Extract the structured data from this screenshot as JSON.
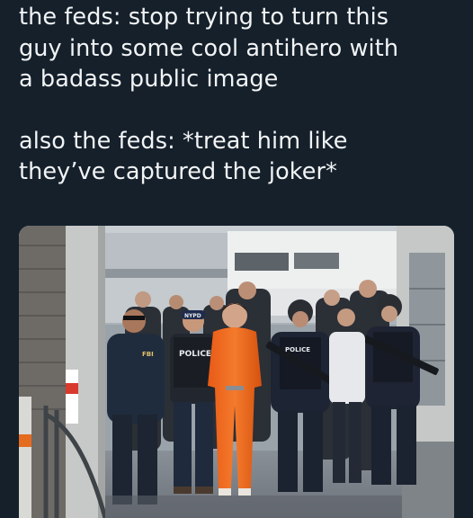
{
  "caption": {
    "line1": "the feds: stop trying to turn this",
    "line2": "guy into some cool antihero with",
    "line3": "a badass public image",
    "line4": "also the feds: *treat him like",
    "line5": "they’ve captured the joker*"
  },
  "photo": {
    "vest_label_1": "POLICE",
    "vest_label_2": "NYPD",
    "cap_label": "NYPD"
  }
}
